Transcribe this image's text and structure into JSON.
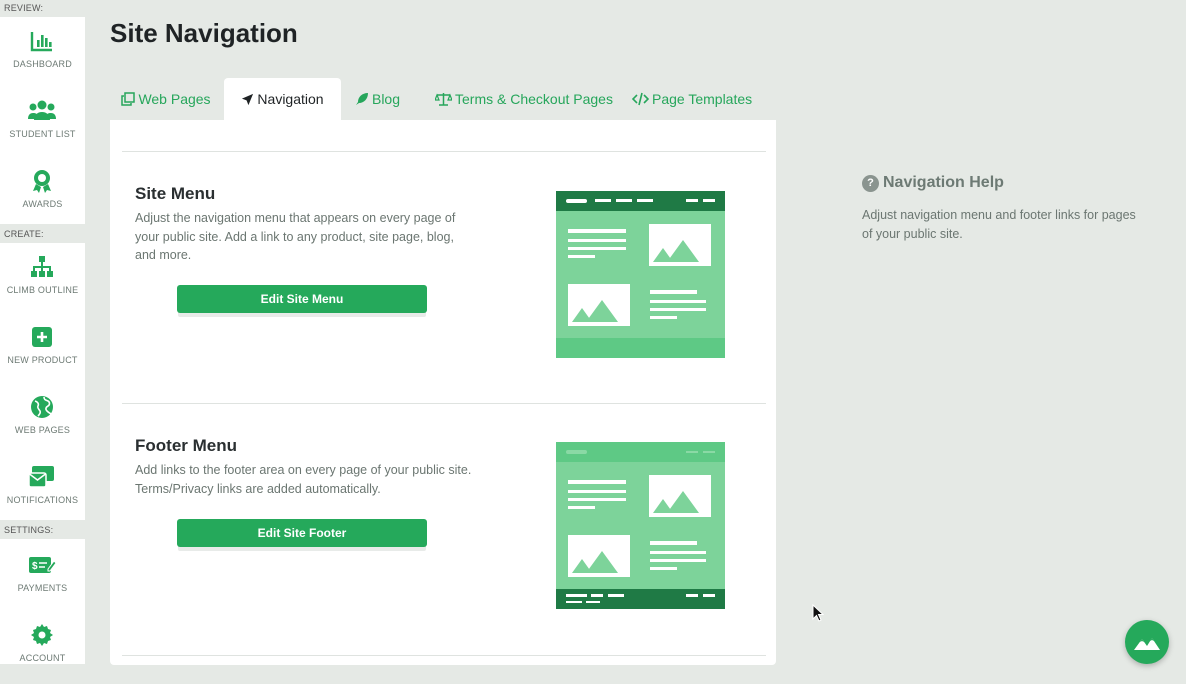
{
  "sidebar": {
    "sections": {
      "review": "REVIEW:",
      "create": "CREATE:",
      "settings": "SETTINGS:"
    },
    "items": [
      {
        "label": "DASHBOARD",
        "icon": "bar-chart-icon"
      },
      {
        "label": "STUDENT LIST",
        "icon": "users-icon"
      },
      {
        "label": "AWARDS",
        "icon": "award-ribbon-icon"
      },
      {
        "label": "CLIMB OUTLINE",
        "icon": "sitemap-icon"
      },
      {
        "label": "NEW PRODUCT",
        "icon": "plus-square-icon"
      },
      {
        "label": "WEB PAGES",
        "icon": "globe-icon"
      },
      {
        "label": "NOTIFICATIONS",
        "icon": "envelope-icon"
      },
      {
        "label": "PAYMENTS",
        "icon": "money-check-icon"
      },
      {
        "label": "ACCOUNT",
        "icon": "gear-icon"
      }
    ]
  },
  "header": {
    "title": "Site Navigation"
  },
  "tabs": [
    {
      "label": "Web Pages",
      "icon": "copy-icon",
      "active": false
    },
    {
      "label": "Navigation",
      "icon": "location-arrow-icon",
      "active": true
    },
    {
      "label": "Blog",
      "icon": "feather-icon",
      "active": false
    },
    {
      "label": "Terms & Checkout Pages",
      "icon": "balance-scale-icon",
      "active": false
    },
    {
      "label": "Page Templates",
      "icon": "code-icon",
      "active": false
    }
  ],
  "cards": [
    {
      "title": "Site Menu",
      "description": "Adjust the navigation menu that appears on every page of your public site. Add a link to any product, site page, blog, and more.",
      "button": "Edit Site Menu"
    },
    {
      "title": "Footer Menu",
      "description": "Add links to the footer area on every page of your public site. Terms/Privacy links are added automatically.",
      "button": "Edit Site Footer"
    }
  ],
  "help": {
    "title": "Navigation Help",
    "text": "Adjust navigation menu and footer links for pages of your public site."
  },
  "colors": {
    "accent": "#25a95b",
    "dark_green": "#1f7a45",
    "light_green": "#7dd39a",
    "mid_green": "#5ec985",
    "background": "#e5e9e5"
  },
  "fab": {
    "icon": "mountain-logo-icon"
  }
}
